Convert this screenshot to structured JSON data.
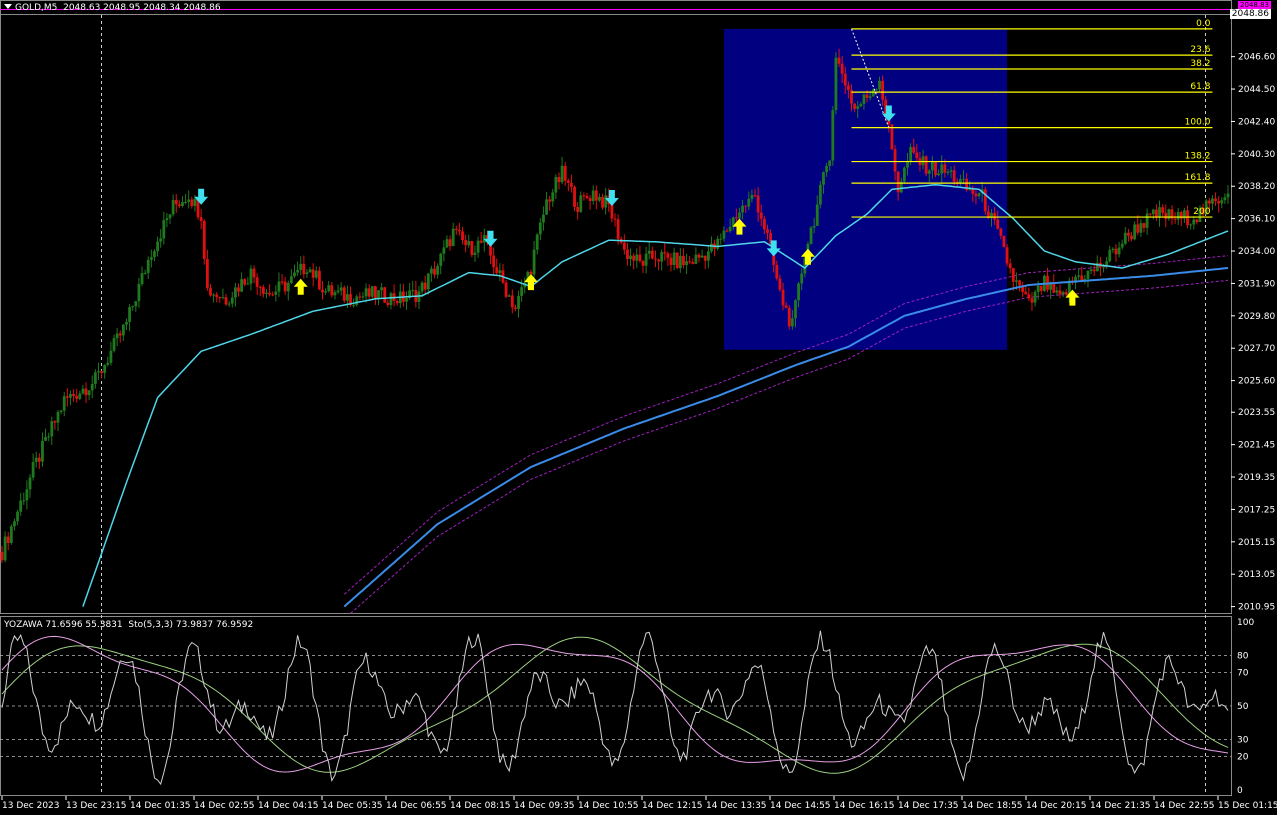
{
  "header": {
    "symbol": "GOLD,M5",
    "ohlc": "2048.63 2048.95 2048.34 2048.86",
    "current_price": "2048.86",
    "marker_price": "2048.83"
  },
  "subwindow": {
    "label": "YOZAWA 71.6596 55.3831",
    "stoch_label": "Sto(5,3,3) 73.9837 76.9592"
  },
  "colors": {
    "bull": "#1f7a1f",
    "bear": "#e01010",
    "fast_ma": "#4fd6e8",
    "slow_ma": "#3a8ce8",
    "band": "#a020c0",
    "fib": "#ffff00",
    "zone": "#000080",
    "buy_arrow": "#ffff00",
    "sell_arrow": "#40e0f0",
    "grid": "#ffffff"
  },
  "chart_data": [
    {
      "type": "candlestick",
      "title": "GOLD,M5",
      "price_ticks": [
        "2046.60",
        "2044.50",
        "2042.40",
        "2040.30",
        "2038.20",
        "2036.10",
        "2034.00",
        "2031.90",
        "2029.80",
        "2027.70",
        "2025.60",
        "2023.55",
        "2021.45",
        "2019.35",
        "2017.25",
        "2015.15",
        "2013.05",
        "2010.95"
      ],
      "ylim": [
        2010.6,
        2049.3
      ],
      "time_ticks": [
        "13 Dec 2023",
        "13 Dec 23:15",
        "14 Dec 01:35",
        "14 Dec 02:55",
        "14 Dec 04:15",
        "14 Dec 05:35",
        "14 Dec 06:55",
        "14 Dec 08:15",
        "14 Dec 09:35",
        "14 Dec 10:55",
        "14 Dec 12:15",
        "14 Dec 13:35",
        "14 Dec 14:55",
        "14 Dec 16:15",
        "14 Dec 17:35",
        "14 Dec 18:55",
        "14 Dec 20:15",
        "14 Dec 21:35",
        "14 Dec 22:55",
        "15 Dec 01:15"
      ],
      "close_series": [
        {
          "i": 0,
          "v": 2014.5
        },
        {
          "i": 10,
          "v": 2019.8
        },
        {
          "i": 20,
          "v": 2024.3
        },
        {
          "i": 30,
          "v": 2025.6
        },
        {
          "i": 40,
          "v": 2029.3
        },
        {
          "i": 48,
          "v": 2034.0
        },
        {
          "i": 55,
          "v": 2036.9
        },
        {
          "i": 60,
          "v": 2037.7
        },
        {
          "i": 64,
          "v": 2036.4
        },
        {
          "i": 66,
          "v": 2031.5
        },
        {
          "i": 72,
          "v": 2030.9
        },
        {
          "i": 80,
          "v": 2032.6
        },
        {
          "i": 86,
          "v": 2031.2
        },
        {
          "i": 92,
          "v": 2031.9
        },
        {
          "i": 98,
          "v": 2033.1
        },
        {
          "i": 104,
          "v": 2031.4
        },
        {
          "i": 112,
          "v": 2031.0
        },
        {
          "i": 120,
          "v": 2031.2
        },
        {
          "i": 128,
          "v": 2030.9
        },
        {
          "i": 134,
          "v": 2031.3
        },
        {
          "i": 140,
          "v": 2033.1
        },
        {
          "i": 145,
          "v": 2035.2
        },
        {
          "i": 150,
          "v": 2034.2
        },
        {
          "i": 155,
          "v": 2034.6
        },
        {
          "i": 160,
          "v": 2032.3
        },
        {
          "i": 165,
          "v": 2030.3
        },
        {
          "i": 170,
          "v": 2033.0
        },
        {
          "i": 175,
          "v": 2037.2
        },
        {
          "i": 180,
          "v": 2039.0
        },
        {
          "i": 185,
          "v": 2037.0
        },
        {
          "i": 190,
          "v": 2037.8
        },
        {
          "i": 195,
          "v": 2036.9
        },
        {
          "i": 200,
          "v": 2034.0
        },
        {
          "i": 205,
          "v": 2033.2
        },
        {
          "i": 210,
          "v": 2033.7
        },
        {
          "i": 215,
          "v": 2033.4
        },
        {
          "i": 220,
          "v": 2033.2
        },
        {
          "i": 225,
          "v": 2033.7
        },
        {
          "i": 230,
          "v": 2034.4
        },
        {
          "i": 236,
          "v": 2036.4
        },
        {
          "i": 242,
          "v": 2037.6
        },
        {
          "i": 246,
          "v": 2034.9
        },
        {
          "i": 250,
          "v": 2031.2
        },
        {
          "i": 254,
          "v": 2029.1
        },
        {
          "i": 258,
          "v": 2033.9
        },
        {
          "i": 262,
          "v": 2036.9
        },
        {
          "i": 266,
          "v": 2040.4
        },
        {
          "i": 268,
          "v": 2046.4
        },
        {
          "i": 270,
          "v": 2045.6
        },
        {
          "i": 274,
          "v": 2043.2
        },
        {
          "i": 278,
          "v": 2044.0
        },
        {
          "i": 282,
          "v": 2045.2
        },
        {
          "i": 285,
          "v": 2041.8
        },
        {
          "i": 288,
          "v": 2038.1
        },
        {
          "i": 292,
          "v": 2040.3
        },
        {
          "i": 296,
          "v": 2039.6
        },
        {
          "i": 300,
          "v": 2039.3
        },
        {
          "i": 305,
          "v": 2039.0
        },
        {
          "i": 310,
          "v": 2038.0
        },
        {
          "i": 315,
          "v": 2037.5
        },
        {
          "i": 320,
          "v": 2035.1
        },
        {
          "i": 325,
          "v": 2032.2
        },
        {
          "i": 330,
          "v": 2030.5
        },
        {
          "i": 335,
          "v": 2031.9
        },
        {
          "i": 340,
          "v": 2030.8
        },
        {
          "i": 345,
          "v": 2032.3
        },
        {
          "i": 350,
          "v": 2032.6
        },
        {
          "i": 355,
          "v": 2033.4
        },
        {
          "i": 360,
          "v": 2034.6
        },
        {
          "i": 366,
          "v": 2035.8
        },
        {
          "i": 372,
          "v": 2036.4
        },
        {
          "i": 378,
          "v": 2036.1
        },
        {
          "i": 384,
          "v": 2036.3
        },
        {
          "i": 390,
          "v": 2037.2
        },
        {
          "i": 394,
          "v": 2038.0
        }
      ],
      "fast_ma": [
        {
          "i": 26,
          "v": 2010.95
        },
        {
          "i": 40,
          "v": 2019.0
        },
        {
          "i": 50,
          "v": 2024.5
        },
        {
          "i": 64,
          "v": 2027.5
        },
        {
          "i": 80,
          "v": 2028.6
        },
        {
          "i": 100,
          "v": 2030.1
        },
        {
          "i": 120,
          "v": 2030.9
        },
        {
          "i": 135,
          "v": 2031.1
        },
        {
          "i": 150,
          "v": 2032.6
        },
        {
          "i": 160,
          "v": 2032.4
        },
        {
          "i": 170,
          "v": 2031.7
        },
        {
          "i": 180,
          "v": 2033.3
        },
        {
          "i": 195,
          "v": 2034.7
        },
        {
          "i": 210,
          "v": 2034.6
        },
        {
          "i": 230,
          "v": 2034.3
        },
        {
          "i": 245,
          "v": 2034.6
        },
        {
          "i": 258,
          "v": 2032.9
        },
        {
          "i": 268,
          "v": 2035.0
        },
        {
          "i": 278,
          "v": 2036.4
        },
        {
          "i": 286,
          "v": 2038.0
        },
        {
          "i": 300,
          "v": 2038.3
        },
        {
          "i": 314,
          "v": 2038.0
        },
        {
          "i": 325,
          "v": 2036.1
        },
        {
          "i": 335,
          "v": 2034.0
        },
        {
          "i": 345,
          "v": 2033.3
        },
        {
          "i": 360,
          "v": 2032.9
        },
        {
          "i": 375,
          "v": 2033.8
        },
        {
          "i": 394,
          "v": 2035.3
        }
      ],
      "slow_ma": [
        {
          "i": 110,
          "v": 2010.95
        },
        {
          "i": 140,
          "v": 2016.3
        },
        {
          "i": 170,
          "v": 2020.0
        },
        {
          "i": 200,
          "v": 2022.5
        },
        {
          "i": 230,
          "v": 2024.6
        },
        {
          "i": 255,
          "v": 2026.6
        },
        {
          "i": 272,
          "v": 2027.8
        },
        {
          "i": 290,
          "v": 2029.8
        },
        {
          "i": 310,
          "v": 2030.9
        },
        {
          "i": 330,
          "v": 2031.8
        },
        {
          "i": 350,
          "v": 2032.1
        },
        {
          "i": 370,
          "v": 2032.4
        },
        {
          "i": 394,
          "v": 2032.9
        }
      ],
      "band_offset": 0.8,
      "sell_arrows": [
        64,
        157,
        196,
        248,
        285
      ],
      "buy_arrows": [
        96,
        170,
        237,
        259,
        344
      ],
      "zone": {
        "i_start": 232,
        "i_end": 323,
        "v_top": 2048.4,
        "v_bottom": 2027.6
      },
      "fibonacci": {
        "i_start": 273,
        "i_end": 389,
        "levels": [
          {
            "label": "0.0",
            "v": 2048.4
          },
          {
            "label": "23.6",
            "v": 2046.7
          },
          {
            "label": "38.2",
            "v": 2045.8
          },
          {
            "label": "61.8",
            "v": 2044.3
          },
          {
            "label": "100.0",
            "v": 2042.0
          },
          {
            "label": "138.2",
            "v": 2039.8
          },
          {
            "label": "161.8",
            "v": 2038.4
          },
          {
            "label": "200",
            "v": 2036.2
          }
        ]
      }
    },
    {
      "type": "line",
      "title": "YOZAWA 71.6596 55.3831",
      "levels": [
        80,
        70,
        50,
        30,
        20
      ],
      "y_ticks": [
        "100",
        "80",
        "70",
        "50",
        "30",
        "20",
        "0"
      ],
      "ylim": [
        0,
        100
      ],
      "series": [
        {
          "name": "Sto(5,3,3)",
          "color": "#e8a0e8"
        },
        {
          "name": "YOZAWA",
          "color": "#d0d0d0"
        }
      ]
    }
  ]
}
